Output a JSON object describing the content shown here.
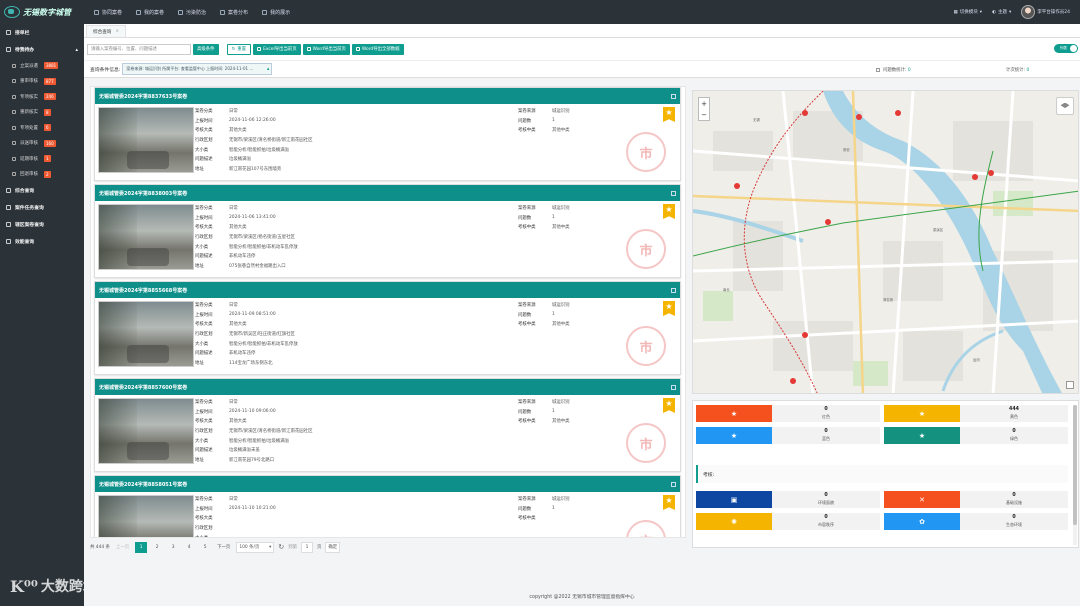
{
  "app": {
    "logo_text": "无锡数字城管",
    "topnav": [
      "协同案卷",
      "我的案卷",
      "污染防治",
      "案卷分布",
      "我的展示"
    ],
    "top_right": {
      "switch_system": "切换模块",
      "theme": "主题",
      "user": "李平台操作员24"
    }
  },
  "sidebar": {
    "items": [
      {
        "label": "接单栏"
      },
      {
        "label": "待我待办",
        "open": true
      }
    ],
    "sub_items": [
      {
        "label": "立案派遣",
        "badge": "3881"
      },
      {
        "label": "重审审核",
        "badge": "877"
      },
      {
        "label": "专项核实",
        "badge": "246"
      },
      {
        "label": "重新核实",
        "badge": "8"
      },
      {
        "label": "专项处置",
        "badge": "6"
      },
      {
        "label": "派送审核",
        "badge": "160"
      },
      {
        "label": "延期审核",
        "badge": "1"
      },
      {
        "label": "回退审核",
        "badge": "2"
      }
    ],
    "bottom_items": [
      {
        "label": "综合查询"
      },
      {
        "label": "案件任务查询"
      },
      {
        "label": "辖区案卷查询"
      },
      {
        "label": "效能查询"
      }
    ]
  },
  "tabs": [
    {
      "label": "综合查询"
    }
  ],
  "toolbar": {
    "search_placeholder": "请输入案卷编号、位置、问题描述",
    "btn_advanced": "高级条件",
    "btn_reset": "重置",
    "btn_excel": "Excel导出当前页",
    "btn_word_current": "Word导出当前页",
    "btn_word_all": "Word导出全部数据",
    "switch_label": "列表"
  },
  "conditions": {
    "label": "查询条件信息:",
    "value": "案卷来源: 城运识别 所属平台: 查看监管中心 上报时间: 2024-11-01 ...",
    "issue_count_label": "问题数统计:",
    "issue_count": "0",
    "times_label": "计次统计:",
    "times": "0"
  },
  "field_labels": {
    "category": "案卷分类",
    "report_time": "上报时间",
    "main_class": "考核大类",
    "district": "行政区划",
    "big_class": "大小类",
    "description": "问题描述",
    "address": "地址",
    "source": "案卷来源",
    "issues": "问题数",
    "assess": "考核中类"
  },
  "cards": [
    {
      "title": "无锡城管委2024字第8837633号案卷",
      "category": "日常",
      "report_time": "2024-11-06 12:26:00",
      "main_class": "其他大类",
      "district": "无锡市/梁溪区/清名桥街道/新江南花园社区",
      "big_class": "智能分析/智能抓拍/垃圾桶满溢",
      "description": "垃圾桶满溢",
      "address": "新江南花园107号东围墙旁",
      "source": "城运识别",
      "issues": "1",
      "assess": "其他中类"
    },
    {
      "title": "无锡城管委2024字第8838003号案卷",
      "category": "日常",
      "report_time": "2024-11-06 13:41:00",
      "main_class": "其他大类",
      "district": "无锡市/梁溪区/扬名街道/五星社区",
      "big_class": "智能分析/智能抓拍/非机动车乱停放",
      "description": "非机动车违停",
      "address": "075张巷自然村金福路出入口",
      "source": "城运识别",
      "issues": "1",
      "assess": "其他中类"
    },
    {
      "title": "无锡城管委2024字第8855668号案卷",
      "category": "日常",
      "report_time": "2024-11-09 08:51:00",
      "main_class": "其他大类",
      "district": "无锡市/新吴区/旺庄街道/红旗社区",
      "big_class": "智能分析/智能抓拍/非机动车乱停放",
      "description": "非机动车违停",
      "address": "114宝龙广场东侧东北",
      "source": "城运识别",
      "issues": "1",
      "assess": "其他中类"
    },
    {
      "title": "无锡城管委2024字第8857600号案卷",
      "category": "日常",
      "report_time": "2024-11-10 09:06:00",
      "main_class": "其他大类",
      "district": "无锡市/梁溪区/清名桥街道/新江南花园社区",
      "big_class": "智能分析/智能抓拍/垃圾桶满溢",
      "description": "垃圾桶满溢未盖",
      "address": "新江南花园79号北路口",
      "source": "城运识别",
      "issues": "1",
      "assess": "其他中类"
    },
    {
      "title": "无锡城管委2024字第8858051号案卷",
      "category": "日常",
      "report_time": "2024-11-10 10:21:00",
      "main_class": "",
      "district": "",
      "big_class": "",
      "description": "",
      "address": "",
      "source": "城运识别",
      "issues": "1",
      "assess": ""
    }
  ],
  "seal_char": "市",
  "pager": {
    "total": "共 444 条",
    "prev": "上一页",
    "pages": [
      "1",
      "2",
      "3",
      "4",
      "5"
    ],
    "next": "下一页",
    "per_page": "100 条/页",
    "goto_label": "到第",
    "goto_value": "1",
    "page_unit": "页",
    "confirm": "确定"
  },
  "map": {
    "zoom_in": "+",
    "zoom_out": "−"
  },
  "stats": {
    "rows": [
      [
        {
          "value": "0",
          "name": "红色",
          "color": "#f4511e",
          "icon": "★"
        },
        {
          "value": "444",
          "name": "黄色",
          "color": "#f5b400",
          "icon": "★"
        }
      ],
      [
        {
          "value": "0",
          "name": "蓝色",
          "color": "#2196f3",
          "icon": "★"
        },
        {
          "value": "0",
          "name": "绿色",
          "color": "#14917f",
          "icon": "★"
        }
      ]
    ],
    "kaohe_label": "考核:",
    "rows2": [
      [
        {
          "value": "0",
          "name": "环境面貌",
          "color": "#0d47a1",
          "icon": "▣"
        },
        {
          "value": "0",
          "name": "基础设施",
          "color": "#f4511e",
          "icon": "✕"
        }
      ],
      [
        {
          "value": "0",
          "name": "市容秩序",
          "color": "#f5b400",
          "icon": "✺"
        },
        {
          "value": "0",
          "name": "生态环境",
          "color": "#2196f3",
          "icon": "✿"
        }
      ]
    ]
  },
  "footer": "copyright @2022 无锡市城市管理监督指挥中心",
  "watermark": "大数跨境"
}
